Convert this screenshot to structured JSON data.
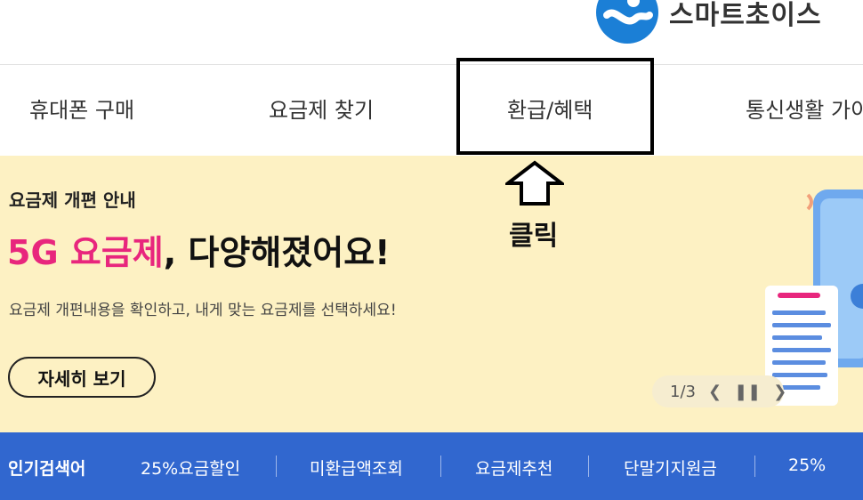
{
  "header": {
    "logo_text": "스마트초이스",
    "brand_color": "#1b7fd6"
  },
  "nav": {
    "items": [
      {
        "label": "휴대폰 구매"
      },
      {
        "label": "요금제 찾기"
      },
      {
        "label": "환급/혜택"
      },
      {
        "label": "통신생활 가이"
      }
    ]
  },
  "annotation": {
    "text": "클릭",
    "icon": "up-arrow-icon"
  },
  "banner": {
    "subtitle": "요금제 개편 안내",
    "title_accent": "5G 요금제",
    "title_rest": ", 다양해졌어요!",
    "description": "요금제 개편내용을 확인하고, 내게 맞는 요금제를 선택하세요!",
    "button_label": "자세히 보기",
    "pager": {
      "current": "1/3",
      "prev_icon": "chevron-left-icon",
      "pause_icon": "pause-icon",
      "next_icon": "chevron-right-icon"
    },
    "accent_color": "#e8267d",
    "background": "#fdf1c3"
  },
  "popular": {
    "label": "인기검색어",
    "items": [
      "25%요금할인",
      "미환급액조회",
      "요금제추천",
      "단말기지원금",
      "25%"
    ],
    "background": "#3167cf"
  }
}
